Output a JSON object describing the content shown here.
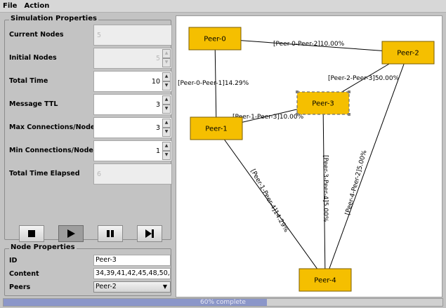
{
  "menu": {
    "file": "File",
    "action": "Action"
  },
  "sim": {
    "title": "Simulation Properties",
    "current_nodes": {
      "label": "Current Nodes",
      "value": "5"
    },
    "initial_nodes": {
      "label": "Initial Nodes",
      "value": "5"
    },
    "total_time": {
      "label": "Total Time",
      "value": "10"
    },
    "message_ttl": {
      "label": "Message TTL",
      "value": "3"
    },
    "max_conn": {
      "label": "Max Connections/Node",
      "value": "3"
    },
    "min_conn": {
      "label": "Min Connections/Node",
      "value": "1"
    },
    "elapsed": {
      "label": "Total Time Elapsed",
      "value": "6"
    }
  },
  "controls": {
    "stop": "stop-icon",
    "play": "play-icon",
    "pause": "pause-icon",
    "step": "step-forward-icon"
  },
  "node": {
    "title": "Node Properties",
    "id_label": "ID",
    "id_value": "Peer-3",
    "content_label": "Content",
    "content_value": "34,39,41,42,45,48,50,",
    "peers_label": "Peers",
    "peers_value": "Peer-2"
  },
  "graph": {
    "colors": {
      "node_fill": "#f5bf00",
      "node_border": "#7a5c00",
      "selected_border": "#707070",
      "edge": "#000000"
    },
    "nodes": [
      {
        "id": "peer-0",
        "label": "Peer-0",
        "selected": false
      },
      {
        "id": "peer-1",
        "label": "Peer-1",
        "selected": false
      },
      {
        "id": "peer-2",
        "label": "Peer-2",
        "selected": false
      },
      {
        "id": "peer-3",
        "label": "Peer-3",
        "selected": true
      },
      {
        "id": "peer-4",
        "label": "Peer-4",
        "selected": false
      }
    ],
    "edges": [
      {
        "id": "e02",
        "label": "[Peer-0-Peer-2]10.00%"
      },
      {
        "id": "e01",
        "label": "[Peer-0-Peer-1]14.29%"
      },
      {
        "id": "e23",
        "label": "[Peer-2-Peer-3]50.00%"
      },
      {
        "id": "e13",
        "label": "[Peer-1-Peer-3]10.00%"
      },
      {
        "id": "e14",
        "label": "[Peer-1-Peer-4]14.29%"
      },
      {
        "id": "e34",
        "label": "[Peer-3-Peer-4]5.00%"
      },
      {
        "id": "e24",
        "label": "[Peer-4-Peer-2]5.00%"
      }
    ]
  },
  "progress": {
    "fraction": 0.6,
    "text": "60% complete",
    "fill_color": "#8b96c9"
  }
}
